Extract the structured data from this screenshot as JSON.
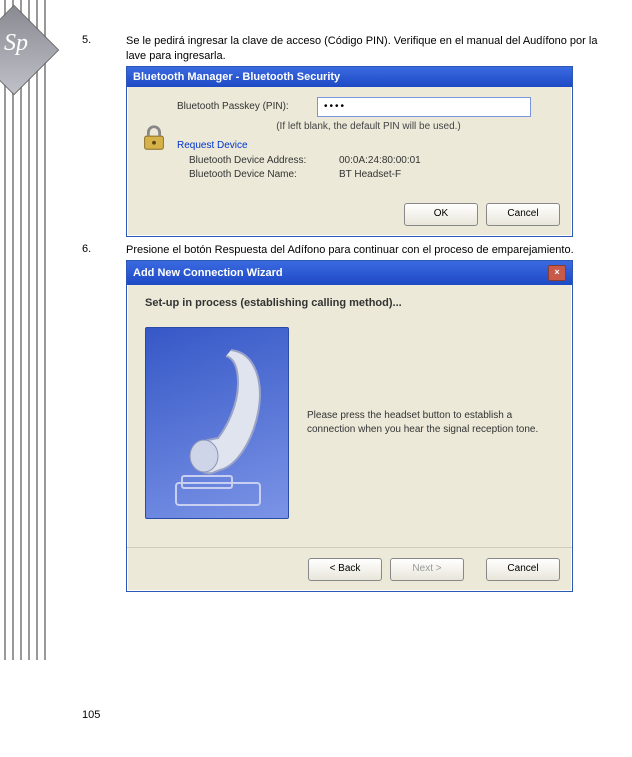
{
  "decor_label": "Sp",
  "steps": {
    "five": {
      "num": "5.",
      "text": "Se le pedirá ingresar la clave de acceso (Código PIN). Verifique en el manual del Audífono por la lave para ingresarla."
    },
    "six": {
      "num": "6.",
      "text": "Presione el botón Respuesta del Adífono para continuar con el proceso de emparejamiento."
    }
  },
  "dialog1": {
    "title": "Bluetooth Manager  -  Bluetooth Security",
    "passkey_label": "Bluetooth Passkey (PIN):",
    "passkey_value": "••••",
    "hint": "(If left blank, the default PIN will be used.)",
    "group_title": "Request Device",
    "addr_label": "Bluetooth Device Address:",
    "addr_value": "00:0A:24:80:00:01",
    "name_label": "Bluetooth Device Name:",
    "name_value": "BT Headset-F",
    "ok": "OK",
    "cancel": "Cancel"
  },
  "dialog2": {
    "title": "Add New Connection Wizard",
    "heading": "Set-up in process (establishing calling method)...",
    "msg": "Please press the headset button to establish a connection when you hear the signal reception tone.",
    "back": "< Back",
    "next": "Next >",
    "cancel": "Cancel"
  },
  "page_number": "105"
}
